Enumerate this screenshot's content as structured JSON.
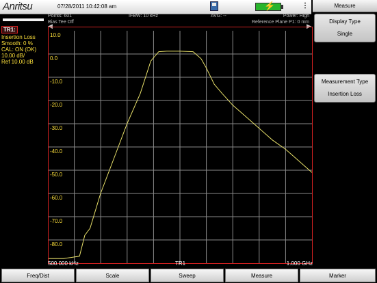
{
  "status_bar": {
    "brand": "Anritsu",
    "datetime": "07/28/2011 10:42:08 am"
  },
  "info_bar": {
    "points": "Points: 601",
    "bias_tee": "Bias Tee Off",
    "ifbw": "IFBW: 10 kHz",
    "avg": "AVG: --",
    "power": "Power: High",
    "ref_plane": "Reference Plane P1: 0 mm"
  },
  "trace_panel": {
    "label": "TR1:",
    "lines": [
      "Insertion Loss",
      "Smooth: 0 %",
      "CAL: ON (OK)",
      "10.00 dB/",
      "Ref 10.00 dB"
    ]
  },
  "footer": {
    "start_freq": "500.000 kHz",
    "trace": "TR1",
    "stop_freq": "1.000 GHz"
  },
  "menu": {
    "title": "Measure",
    "display_type_label": "Display Type",
    "display_type_value": "Single",
    "measurement_type_label": "Measurement Type",
    "measurement_type_value": "Insertion Loss"
  },
  "bottom_menu": [
    "Freq/Dist",
    "Scale",
    "Sweep",
    "Measure",
    "Marker"
  ],
  "colors": {
    "trace": "#e8e06a",
    "grid": "#8a8a8a",
    "border": "#d02020",
    "label_text": "#ffe23c"
  },
  "chart_data": {
    "type": "line",
    "title": "",
    "xlabel": "",
    "ylabel": "",
    "ylim": [
      -90,
      10
    ],
    "yticks": [
      "10.0",
      "0.0",
      "-10.0",
      "-20.0",
      "-30.0",
      "-40.0",
      "-50.0",
      "-60.0",
      "-70.0",
      "-80.0"
    ],
    "ytick_values": [
      10,
      0,
      -10,
      -20,
      -30,
      -40,
      -50,
      -60,
      -70,
      -80
    ],
    "xlim": [
      0.0005,
      1.0
    ],
    "x_unit": "GHz",
    "grid": true,
    "series": [
      {
        "points": [
          [
            0.0005,
            -88
          ],
          [
            0.06,
            -88
          ],
          [
            0.12,
            -87
          ],
          [
            0.14,
            -78
          ],
          [
            0.16,
            -75
          ],
          [
            0.2,
            -60
          ],
          [
            0.25,
            -45
          ],
          [
            0.3,
            -30
          ],
          [
            0.35,
            -17
          ],
          [
            0.39,
            -3
          ],
          [
            0.42,
            1
          ],
          [
            0.45,
            1.2
          ],
          [
            0.5,
            1.2
          ],
          [
            0.55,
            1
          ],
          [
            0.58,
            -2
          ],
          [
            0.6,
            -6
          ],
          [
            0.63,
            -13
          ],
          [
            0.66,
            -17
          ],
          [
            0.7,
            -22
          ],
          [
            0.75,
            -27
          ],
          [
            0.8,
            -32
          ],
          [
            0.85,
            -37
          ],
          [
            0.9,
            -41
          ],
          [
            0.95,
            -46
          ],
          [
            1.0,
            -51
          ]
        ]
      }
    ]
  }
}
